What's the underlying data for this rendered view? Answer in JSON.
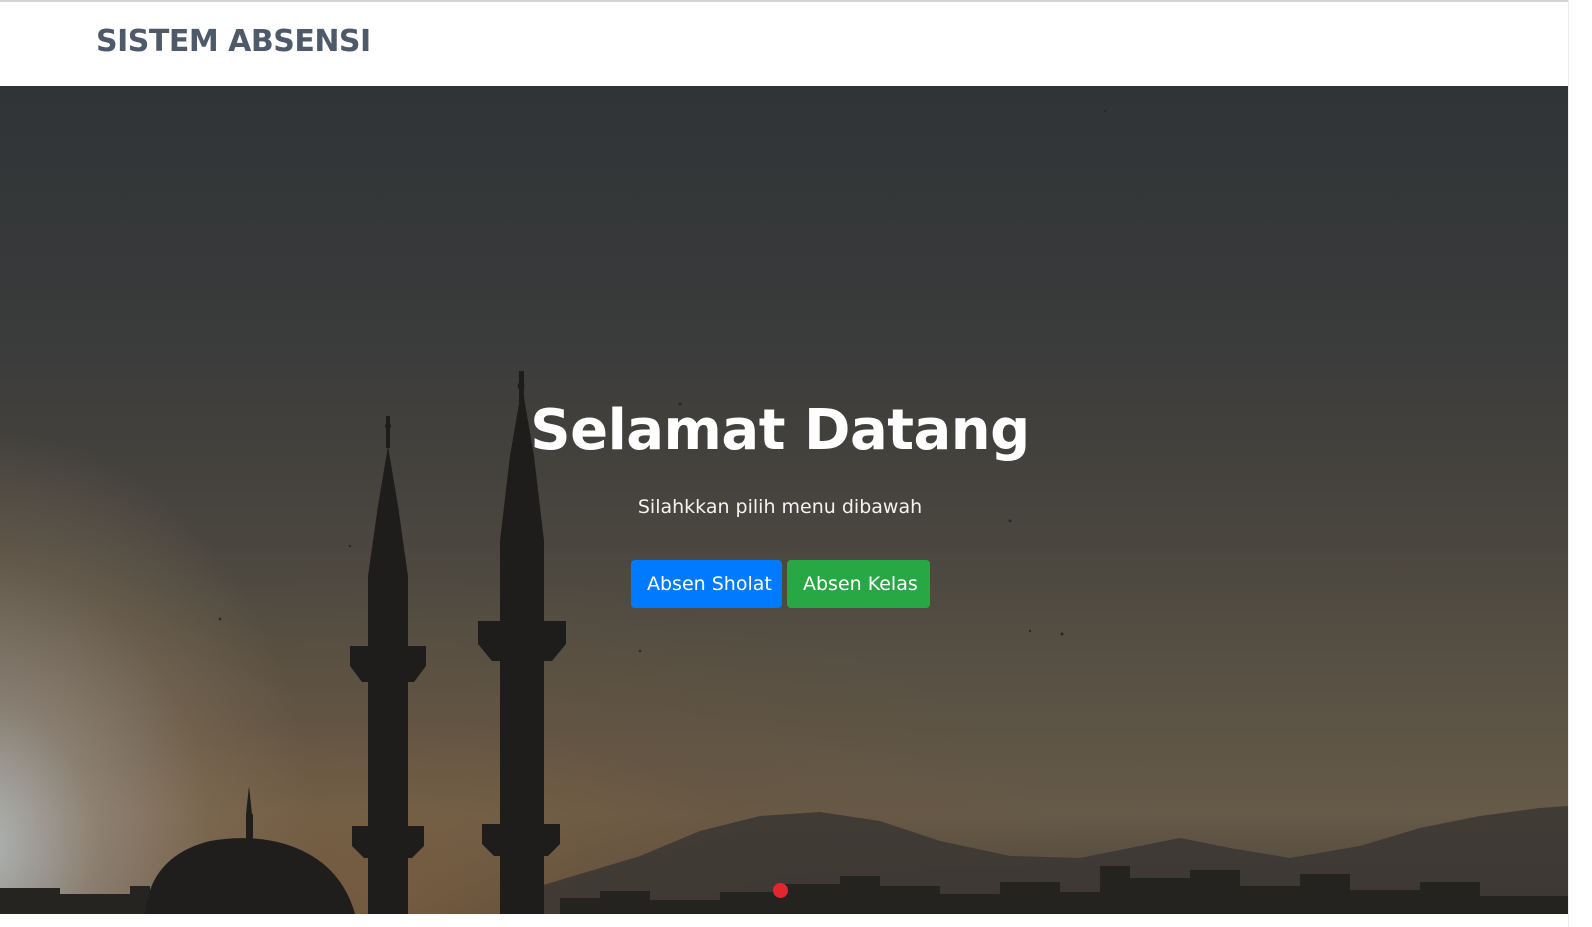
{
  "navbar": {
    "brand": "SISTEM ABSENSI"
  },
  "hero": {
    "title": "Selamat Datang",
    "subtitle": "Silahkkan pilih menu dibawah",
    "background_image": "mosque-minarets-silhouette-at-dusk",
    "buttons": [
      {
        "label": "Absen Sholat",
        "color": "#007bff"
      },
      {
        "label": "Absen Kelas",
        "color": "#28a745"
      }
    ],
    "scroll_indicator_color": "#e3262e"
  },
  "colors": {
    "brand_text": "#4e5a6a",
    "primary": "#007bff",
    "success": "#28a745",
    "hero_text": "#ffffff"
  }
}
